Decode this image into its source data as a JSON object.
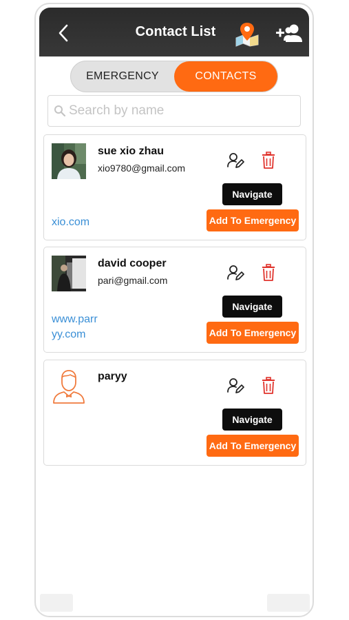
{
  "header": {
    "title": "Contact List",
    "back_icon": "chevron-left-icon",
    "map_icon": "map-pin-icon",
    "add_icon": "add-user-icon"
  },
  "tabs": {
    "emergency_label": "EMERGENCY",
    "contacts_label": "CONTACTS",
    "active": "contacts"
  },
  "search": {
    "placeholder": "Search by name",
    "value": ""
  },
  "contacts": [
    {
      "name": "sue xio zhau",
      "email": "xio9780@gmail.com",
      "website": "xio.com",
      "navigate_label": "Navigate",
      "emergency_label": "Add To Emergency"
    },
    {
      "name": "david cooper",
      "email": "pari@gmail.com",
      "website": "www.parryy.com",
      "navigate_label": "Navigate",
      "emergency_label": "Add To Emergency"
    },
    {
      "name": "paryy",
      "email": "",
      "website": "",
      "navigate_label": "Navigate",
      "emergency_label": "Add To Emergency"
    }
  ],
  "colors": {
    "accent": "#ff6a12",
    "header_bg": "#333333",
    "link": "#3a8fd6",
    "delete": "#e0322b"
  }
}
